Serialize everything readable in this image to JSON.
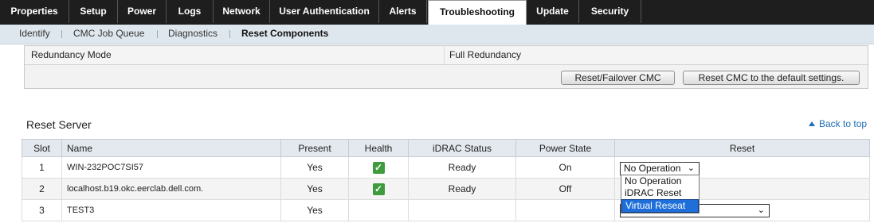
{
  "top_tabs": [
    "Properties",
    "Setup",
    "Power",
    "Logs",
    "Network",
    "User Authentication",
    "Alerts",
    "Troubleshooting",
    "Update",
    "Security"
  ],
  "sub_nav": [
    "Identify",
    "CMC Job Queue",
    "Diagnostics",
    "Reset Components"
  ],
  "redundancy": {
    "label": "Redundancy Mode",
    "value": "Full Redundancy",
    "btn_failover": "Reset/Failover CMC",
    "btn_default": "Reset CMC to the default settings."
  },
  "reset_server": {
    "title": "Reset Server",
    "back_to_top": "Back to top",
    "headers": [
      "Slot",
      "Name",
      "Present",
      "Health",
      "iDRAC Status",
      "Power State",
      "Reset"
    ],
    "rows": [
      {
        "slot": "1",
        "name": "WIN-232POC7SI57",
        "present": "Yes",
        "health": "ok",
        "idrac": "Ready",
        "power": "On",
        "reset": "No Operation"
      },
      {
        "slot": "2",
        "name": "localhost.b19.okc.eerclab.dell.com.",
        "present": "Yes",
        "health": "ok",
        "idrac": "Ready",
        "power": "Off",
        "reset": ""
      },
      {
        "slot": "3",
        "name": "TEST3",
        "present": "Yes",
        "health": "",
        "idrac": "",
        "power": "",
        "reset": ""
      }
    ],
    "dropdown_options": [
      "No Operation",
      "iDRAC Reset",
      "Virtual Reseat"
    ],
    "dropdown_selected": "Virtual Reseat"
  }
}
